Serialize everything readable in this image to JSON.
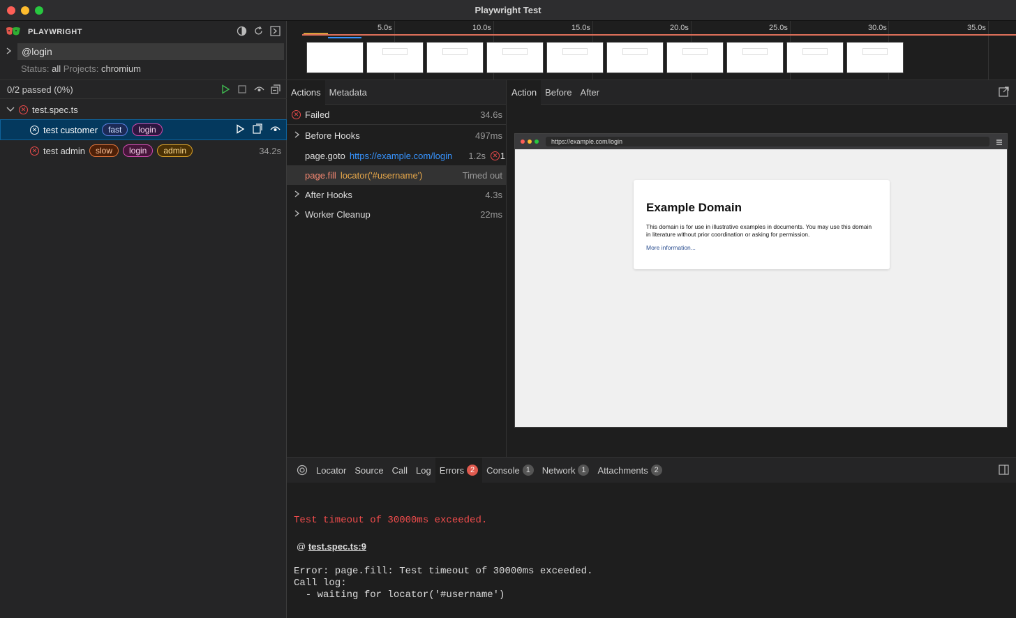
{
  "window": {
    "title": "Playwright Test"
  },
  "sidebar": {
    "brand": "PLAYWRIGHT",
    "filter_value": "@login",
    "status_label": "Status:",
    "status_value": "all",
    "projects_label": "Projects:",
    "projects_value": "chromium",
    "passed_summary": "0/2 passed (0%)",
    "file": "test.spec.ts",
    "tests": [
      {
        "name": "test customer",
        "tags": [
          "fast",
          "login"
        ]
      },
      {
        "name": "test admin",
        "tags": [
          "slow",
          "login",
          "admin"
        ],
        "duration": "34.2s"
      }
    ]
  },
  "timeline": {
    "ticks": [
      "5.0s",
      "10.0s",
      "15.0s",
      "20.0s",
      "25.0s",
      "30.0s",
      "35.0s"
    ]
  },
  "actions_panel": {
    "tabs": [
      "Actions",
      "Metadata"
    ],
    "failed_label": "Failed",
    "failed_duration": "34.6s",
    "rows": [
      {
        "label": "Before Hooks",
        "duration": "497ms"
      },
      {
        "method": "page.goto",
        "arg": "https://example.com/login",
        "duration": "1.2s",
        "error_count": "1"
      },
      {
        "method": "page.fill",
        "arg": "locator('#username')",
        "duration": "Timed out"
      },
      {
        "label": "After Hooks",
        "duration": "4.3s"
      },
      {
        "label": "Worker Cleanup",
        "duration": "22ms"
      }
    ]
  },
  "snapshot_panel": {
    "tabs": [
      "Action",
      "Before",
      "After"
    ],
    "url": "https://example.com/login",
    "page_title": "Example Domain",
    "page_text": "This domain is for use in illustrative examples in documents. You may use this domain in literature without prior coordination or asking for permission.",
    "page_link": "More information..."
  },
  "bottom_panel": {
    "tabs": [
      {
        "label": "Locator"
      },
      {
        "label": "Source"
      },
      {
        "label": "Call"
      },
      {
        "label": "Log"
      },
      {
        "label": "Errors",
        "count": "2"
      },
      {
        "label": "Console",
        "count": "1"
      },
      {
        "label": "Network",
        "count": "1"
      },
      {
        "label": "Attachments",
        "count": "2"
      }
    ],
    "error_title": "Test timeout of 30000ms exceeded.",
    "at_prefix": "@",
    "at_location": "test.spec.ts:9",
    "error_body": "Error: page.fill: Test timeout of 30000ms exceeded.\nCall log:\n  - waiting for locator('#username')"
  },
  "colors": {
    "accent": "#0e639c",
    "error": "#f14c4c",
    "url_blue": "#3794ff",
    "method_orange": "#d7ba7d"
  }
}
